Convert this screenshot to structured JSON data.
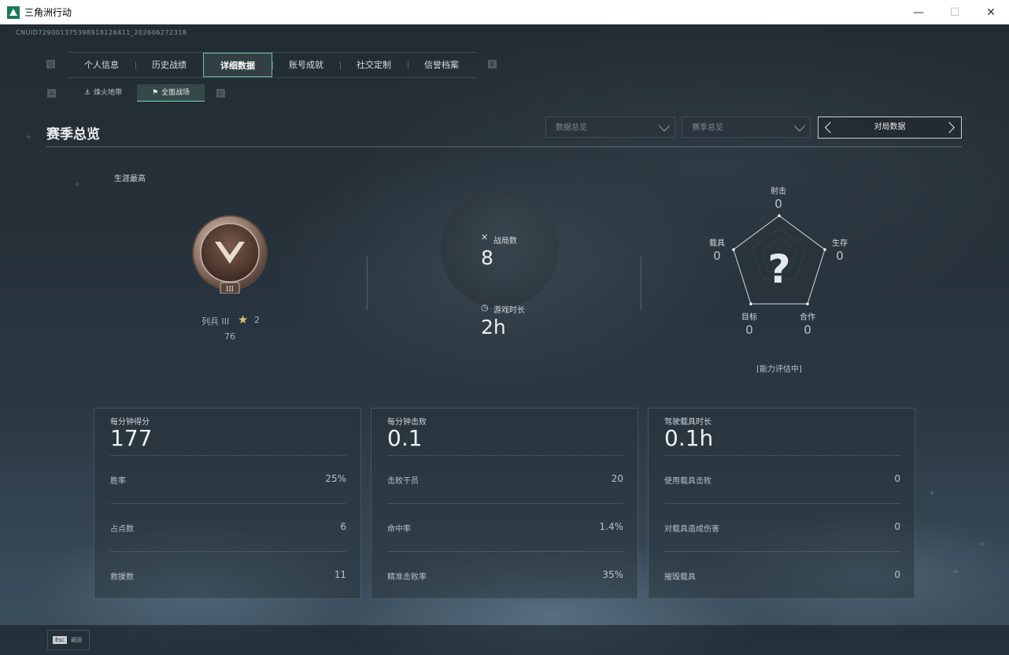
{
  "window": {
    "title": "三角洲行动",
    "controls": {
      "minimize": "—",
      "maximize": "☐",
      "close": "✕"
    }
  },
  "uid": "CNUID729001375398918126411_202606272318",
  "nav": {
    "prev_key": "Q",
    "next_key": "E",
    "tabs": [
      {
        "label": "个人信息",
        "active": false
      },
      {
        "label": "历史战绩",
        "active": false
      },
      {
        "label": "详细数据",
        "active": true
      },
      {
        "label": "账号成就",
        "active": false
      },
      {
        "label": "社交定制",
        "active": false
      },
      {
        "label": "信誉档案",
        "active": false
      }
    ]
  },
  "subnav": {
    "prev_key": "A",
    "next_key": "D",
    "tabs": [
      {
        "label": "烽火地带",
        "active": false
      },
      {
        "label": "全面战场",
        "active": true
      }
    ]
  },
  "section": {
    "title": "赛季总览",
    "data_dropdown": "数据总览",
    "season_dropdown": "赛季总览",
    "match_selector": "对局数据"
  },
  "career": {
    "label": "生涯最高",
    "rank_name": "列兵 III",
    "rank_numeral": "III",
    "stars": "2",
    "score": "76"
  },
  "stats": {
    "matches_label": "战局数",
    "matches_value": "8",
    "playtime_label": "游戏时长",
    "playtime_value": "2h"
  },
  "radar": {
    "shooting_label": "射击",
    "shooting_value": "0",
    "survival_label": "生存",
    "survival_value": "0",
    "teamwork_label": "合作",
    "teamwork_value": "0",
    "objective_label": "目标",
    "objective_value": "0",
    "vehicle_label": "载具",
    "vehicle_value": "0",
    "placeholder": "?",
    "note": "[能力评估中]"
  },
  "cards": [
    {
      "title": "每分钟得分",
      "value": "177",
      "rows": [
        {
          "label": "胜率",
          "value": "25%"
        },
        {
          "label": "占点数",
          "value": "6"
        },
        {
          "label": "救援数",
          "value": "11"
        }
      ]
    },
    {
      "title": "每分钟击败",
      "value": "0.1",
      "rows": [
        {
          "label": "击败干员",
          "value": "20"
        },
        {
          "label": "命中率",
          "value": "1.4%"
        },
        {
          "label": "精准击败率",
          "value": "35%"
        }
      ]
    },
    {
      "title": "驾驶载具时长",
      "value": "0.1h",
      "rows": [
        {
          "label": "使用载具击败",
          "value": "0"
        },
        {
          "label": "对载具造成伤害",
          "value": "0"
        },
        {
          "label": "摧毁载具",
          "value": "0"
        }
      ]
    }
  ],
  "footer": {
    "esc_key": "Esc",
    "esc_label": "返回"
  },
  "colors": {
    "accent": "#6fbf9c",
    "background": "#1c242a"
  }
}
